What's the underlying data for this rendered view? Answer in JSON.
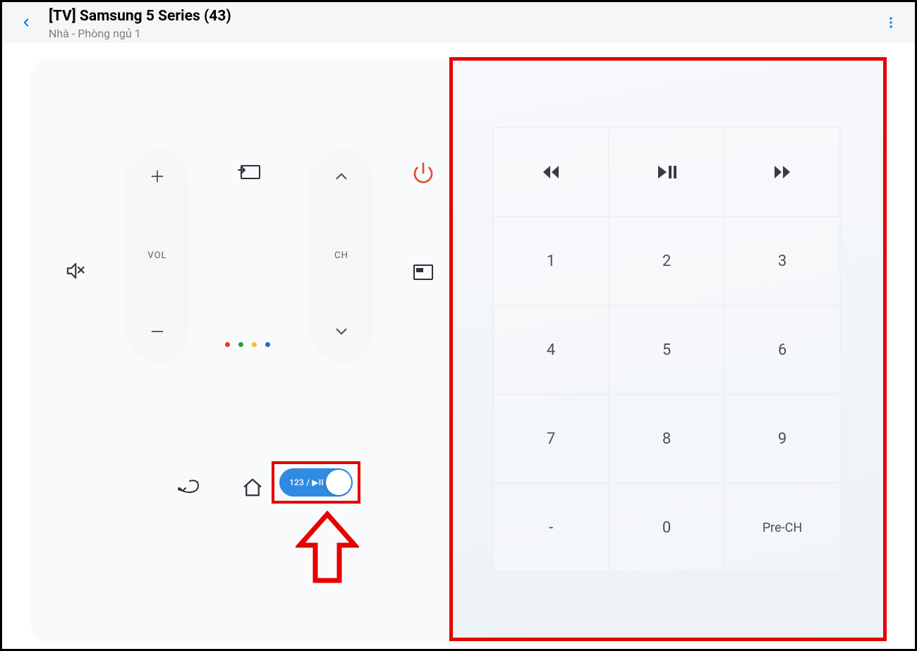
{
  "header": {
    "title": "[TV] Samsung 5 Series (43)",
    "subtitle": "Nhà - Phòng ngủ 1"
  },
  "controls": {
    "vol_label": "VOL",
    "ch_label": "CH"
  },
  "toggle": {
    "label": "123 / ▶II"
  },
  "keypad": {
    "rows": [
      [
        "rewind-icon",
        "play-pause-icon",
        "forward-icon"
      ],
      [
        "1",
        "2",
        "3"
      ],
      [
        "4",
        "5",
        "6"
      ],
      [
        "7",
        "8",
        "9"
      ],
      [
        "-",
        "0",
        "Pre-CH"
      ]
    ],
    "numbers": {
      "r1c0": "1",
      "r1c1": "2",
      "r1c2": "3",
      "r2c0": "4",
      "r2c1": "5",
      "r2c2": "6",
      "r3c0": "7",
      "r3c1": "8",
      "r3c2": "9",
      "r4c0": "-",
      "r4c1": "0",
      "r4c2": "Pre-CH"
    }
  }
}
